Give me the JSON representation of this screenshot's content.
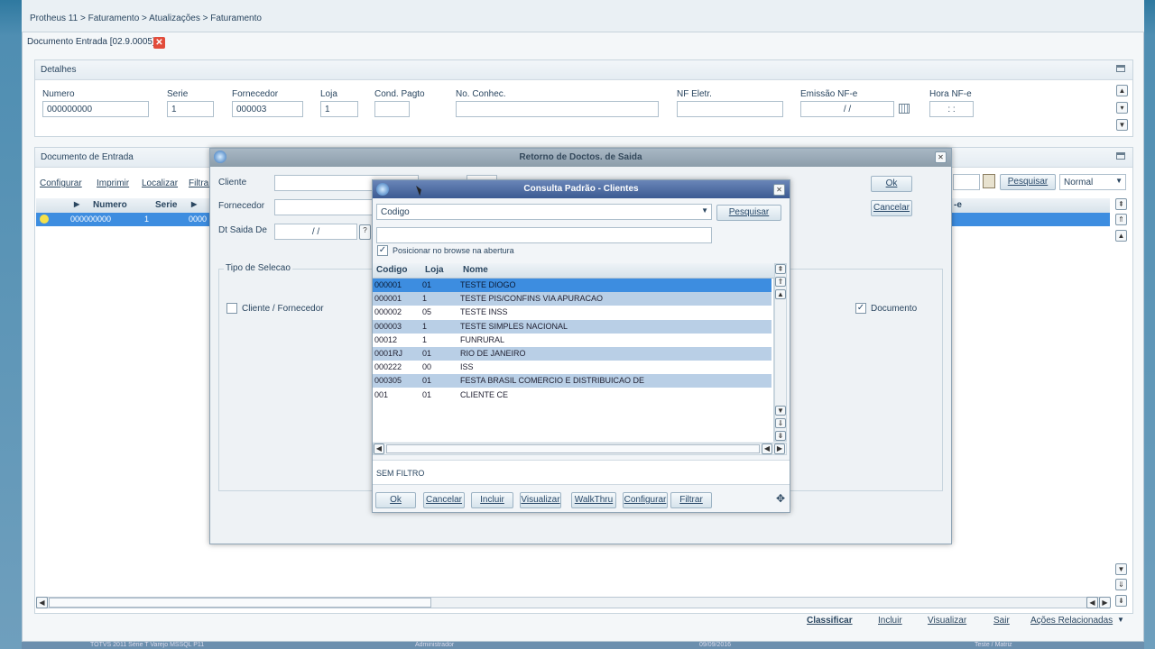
{
  "breadcrumb": "Protheus 11 > Faturamento > Atualizações > Faturamento",
  "tab": {
    "label": "Documento Entrada [02.9.0005]",
    "close": "✕"
  },
  "detalhes": {
    "title": "Detalhes",
    "fields": [
      {
        "label": "Numero",
        "value": "000000000"
      },
      {
        "label": "Serie",
        "value": "1"
      },
      {
        "label": "Fornecedor",
        "value": "000003"
      },
      {
        "label": "Loja",
        "value": "1"
      },
      {
        "label": "Cond. Pagto",
        "value": ""
      },
      {
        "label": "No. Conhec.",
        "value": ""
      },
      {
        "label": "NF Eletr.",
        "value": ""
      },
      {
        "label": "Emissão NF-e",
        "value": "/ /"
      },
      {
        "label": "Hora NF-e",
        "value": ": :"
      }
    ]
  },
  "docentrada": {
    "title": "Documento de Entrada",
    "links": [
      "Configurar",
      "Imprimir",
      "Localizar",
      "Filtrar"
    ],
    "search_label": "Pesquisar",
    "mode_select": "Normal",
    "columns": [
      "Numero",
      "Serie"
    ],
    "row": {
      "numero": "000000000",
      "serie": "1",
      "partial": "0000"
    },
    "right_col": "-e"
  },
  "retorno": {
    "title": "Retorno de Doctos. de Saida",
    "labels": {
      "cliente": "Cliente",
      "fornecedor": "Fornecedor",
      "dtsaida": "Dt Saida De"
    },
    "dt_value": "/ /",
    "ok": "Ok",
    "cancelar": "Cancelar",
    "tipo_selecao": "Tipo de Selecao",
    "cliente_fornecedor": "Cliente / Fornecedor",
    "documento": "Documento"
  },
  "consulta": {
    "title": "Consulta Padrão - Clientes",
    "index_select": "Codigo",
    "pesquisar": "Pesquisar",
    "posicionar": "Posicionar no browse na abertura",
    "columns": [
      "Codigo",
      "Loja",
      "Nome"
    ],
    "rows": [
      {
        "codigo": "000001",
        "loja": "01",
        "nome": "TESTE DIOGO",
        "style": "sel"
      },
      {
        "codigo": "000001",
        "loja": "1",
        "nome": "TESTE PIS/CONFINS VIA APURACAO",
        "style": "alt"
      },
      {
        "codigo": "000002",
        "loja": "05",
        "nome": "TESTE INSS",
        "style": "plain"
      },
      {
        "codigo": "000003",
        "loja": "1",
        "nome": "TESTE SIMPLES NACIONAL",
        "style": "alt"
      },
      {
        "codigo": "00012",
        "loja": "1",
        "nome": "FUNRURAL",
        "style": "plain"
      },
      {
        "codigo": "0001RJ",
        "loja": "01",
        "nome": "RIO DE JANEIRO",
        "style": "alt"
      },
      {
        "codigo": "000222",
        "loja": "00",
        "nome": "ISS",
        "style": "plain"
      },
      {
        "codigo": "000305",
        "loja": "01",
        "nome": "FESTA BRASIL COMERCIO E DISTRIBUICAO DE",
        "style": "alt"
      },
      {
        "codigo": "001",
        "loja": "01",
        "nome": "CLIENTE CE",
        "style": "plain"
      }
    ],
    "filter_text": "SEM FILTRO",
    "buttons": [
      "Ok",
      "Cancelar",
      "Incluir",
      "Visualizar",
      "WalkThru",
      "Configurar",
      "Filtrar"
    ]
  },
  "footer": {
    "actions": [
      "Classificar",
      "Incluir",
      "Visualizar",
      "Sair",
      "Ações Relacionadas"
    ]
  },
  "statusbar": [
    "TOTVS 2011 Série T Varejo MSSQL P11",
    "Administrador",
    "09/09/2016",
    "Teste / Matriz"
  ]
}
